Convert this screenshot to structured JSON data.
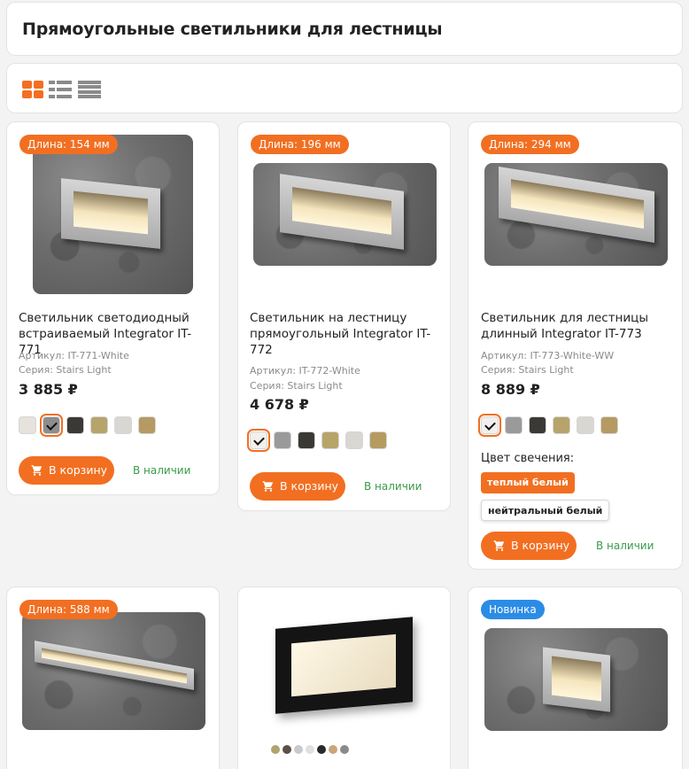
{
  "page_title": "Прямоугольные светильники для лестницы",
  "view_modes": [
    "grid",
    "list",
    "table"
  ],
  "colors": {
    "accent": "#f26f21",
    "new_badge": "#2b8ce6",
    "in_stock": "#3a9a4a"
  },
  "labels": {
    "article": "Артикул:",
    "series": "Серия:",
    "add_to_cart": "В корзину",
    "in_stock": "В наличии",
    "glow_color": "Цвет свечения:"
  },
  "products": [
    {
      "badge": "Длина: 154 мм",
      "name": "Светильник светодиодный встраиваемый Integrator IT-771",
      "article": "Артикул: IT-771-White",
      "series": "Серия: Stairs Light",
      "price": "3 885 ₽",
      "swatches": [
        "#e6e2dc",
        "#8d8d8d",
        "#3a3935",
        "#b7a46a",
        "#d9d7d2",
        "#b59b62"
      ],
      "selected_swatch": 1,
      "button": "В корзину",
      "stock": "В наличии"
    },
    {
      "badge": "Длина: 196 мм",
      "name": "Светильник на лестницу прямоугольный Integrator IT-772",
      "article": "Артикул: IT-772-White",
      "series": "Серия: Stairs Light",
      "price": "4 678 ₽",
      "swatches": [
        "#f2f0ec",
        "#9a9a9a",
        "#3a3935",
        "#b7a46a",
        "#d9d7d2",
        "#b59b62"
      ],
      "selected_swatch": 0,
      "button": "В корзину",
      "stock": "В наличии"
    },
    {
      "badge": "Длина: 294 мм",
      "name": "Светильник для лестницы длинный Integrator IT-773",
      "article": "Артикул: IT-773-White-WW",
      "series": "Серия: Stairs Light",
      "price": "8 889 ₽",
      "swatches": [
        "#f2f0ec",
        "#9a9a9a",
        "#3a3935",
        "#b7a46a",
        "#d9d7d2",
        "#b59b62"
      ],
      "selected_swatch": 0,
      "glow_title": "Цвет свечения:",
      "glow_options": [
        "теплый белый",
        "нейтральный белый"
      ],
      "glow_selected": 0,
      "button": "В корзину",
      "stock": "В наличии"
    },
    {
      "badge": "Длина: 588 мм"
    },
    {
      "badge": "",
      "dots": [
        "#b0a36e",
        "#5a5048",
        "#c9c9c9",
        "#e0e0e0",
        "#2a2a2a",
        "#caa67a",
        "#8a8a8a"
      ]
    },
    {
      "badge": "Новинка"
    }
  ]
}
